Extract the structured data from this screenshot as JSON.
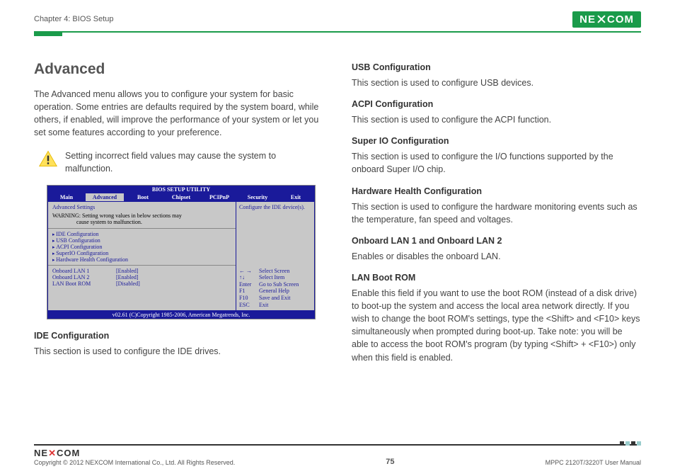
{
  "header": {
    "chapter": "Chapter 4: BIOS Setup",
    "brand": "NEXCOM"
  },
  "left": {
    "title": "Advanced",
    "intro": "The Advanced menu allows you to configure your system for basic operation. Some entries are defaults required by the system board, while others, if enabled, will improve the performance of your system or let you set some features according to your preference.",
    "warning": "Setting incorrect field values may cause the system to malfunction.",
    "ide_heading": "IDE Configuration",
    "ide_text": "This section is used to configure the IDE drives."
  },
  "bios": {
    "title": "BIOS SETUP UTILITY",
    "tabs": [
      "Main",
      "Advanced",
      "Boot",
      "Chipset",
      "PCIPnP",
      "Security",
      "Exit"
    ],
    "active_tab": "Advanced",
    "settings_header": "Advanced Settings",
    "warning_line1": "WARNING: Setting wrong values in below sections may",
    "warning_line2": "cause system to malfunction.",
    "menu": [
      "IDE Configuration",
      "USB Configuration",
      "ACPI Configuration",
      "SuperIO Configuration",
      "Hardware Health Configuration"
    ],
    "kv": [
      {
        "k": "Onboard LAN 1",
        "v": "[Enabled]"
      },
      {
        "k": "Onboard LAN 2",
        "v": "[Enabled]"
      },
      {
        "k": "LAN Boot ROM",
        "v": "[Disabled]"
      }
    ],
    "help_top": "Configure the IDE device(s).",
    "help_keys": [
      {
        "k": "← →",
        "v": "Select Screen"
      },
      {
        "k": "↑↓",
        "v": "Select Item"
      },
      {
        "k": "Enter",
        "v": "Go to Sub Screen"
      },
      {
        "k": "F1",
        "v": "General Help"
      },
      {
        "k": "F10",
        "v": "Save and Exit"
      },
      {
        "k": "ESC",
        "v": "Exit"
      }
    ],
    "footer": "v02.61 (C)Copyright 1985-2006, American Megatrends, Inc."
  },
  "right": {
    "sections": [
      {
        "h": "USB Configuration",
        "p": "This section is used to configure USB devices."
      },
      {
        "h": "ACPI Configuration",
        "p": "This section is used to configure the ACPI function."
      },
      {
        "h": "Super IO Configuration",
        "p": "This section is used to configure the I/O functions supported by the onboard Super I/O chip."
      },
      {
        "h": "Hardware Health Configuration",
        "p": "This section is used to configure the hardware monitoring events such as the temperature, fan speed and voltages."
      },
      {
        "h": "Onboard LAN 1 and Onboard LAN 2",
        "p": "Enables or disables the onboard LAN."
      },
      {
        "h": "LAN Boot ROM",
        "p": "Enable this field if you want to use the boot ROM (instead of a disk drive) to boot-up the system and access the local area network directly. If you wish to change the boot ROM's settings, type the <Shift> and <F10> keys simultaneously when prompted during boot-up. Take note: you will be able to access the boot ROM's program (by typing <Shift> + <F10>) only when this field is enabled."
      }
    ]
  },
  "footer": {
    "brand": "NEXCOM",
    "copyright": "Copyright © 2012 NEXCOM International Co., Ltd. All Rights Reserved.",
    "page": "75",
    "doc": "MPPC 2120T/3220T User Manual"
  }
}
